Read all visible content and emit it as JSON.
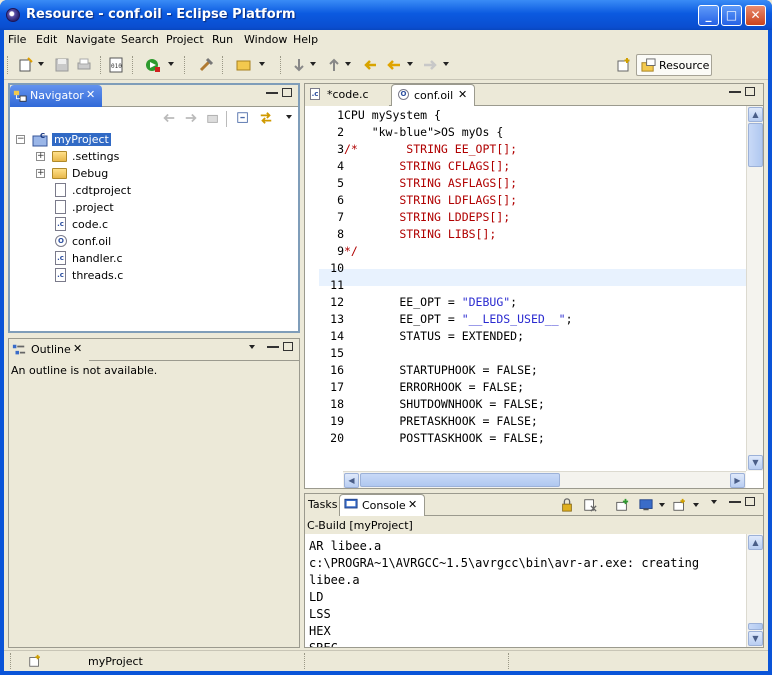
{
  "window": {
    "title": "Resource - conf.oil - Eclipse Platform"
  },
  "menu": [
    "File",
    "Edit",
    "Navigate",
    "Search",
    "Project",
    "Run",
    "Window",
    "Help"
  ],
  "perspective": {
    "label": "Resource"
  },
  "navigator": {
    "tab_label": "Navigator",
    "items": [
      {
        "label": "myProject",
        "icon": "project-icon"
      },
      {
        "label": ".settings",
        "icon": "folder-icon"
      },
      {
        "label": "Debug",
        "icon": "folder-icon"
      },
      {
        "label": ".cdtproject",
        "icon": "file-icon"
      },
      {
        "label": ".project",
        "icon": "file-icon"
      },
      {
        "label": "code.c",
        "icon": "c-file-icon"
      },
      {
        "label": "conf.oil",
        "icon": "oil-file-icon"
      },
      {
        "label": "handler.c",
        "icon": "c-file-icon"
      },
      {
        "label": "threads.c",
        "icon": "c-file-icon"
      }
    ]
  },
  "outline": {
    "tab_label": "Outline",
    "message": "An outline is not available."
  },
  "editor": {
    "tabs": [
      {
        "label": "*code.c"
      },
      {
        "label": "conf.oil"
      }
    ],
    "lines": [
      {
        "n": "1",
        "text": "CPU mySystem {"
      },
      {
        "n": "2",
        "text": "    OS myOs {"
      },
      {
        "n": "3",
        "text": "/*       STRING EE_OPT[];"
      },
      {
        "n": "4",
        "text": "        STRING CFLAGS[];"
      },
      {
        "n": "5",
        "text": "        STRING ASFLAGS[];"
      },
      {
        "n": "6",
        "text": "        STRING LDFLAGS[];"
      },
      {
        "n": "7",
        "text": "        STRING LDDEPS[];"
      },
      {
        "n": "8",
        "text": "        STRING LIBS[];"
      },
      {
        "n": "9",
        "text": "*/"
      },
      {
        "n": "10",
        "text": ""
      },
      {
        "n": "11",
        "text": ""
      },
      {
        "n": "12",
        "text": "        EE_OPT = \"DEBUG\";"
      },
      {
        "n": "13",
        "text": "        EE_OPT = \"__LEDS_USED__\";"
      },
      {
        "n": "14",
        "text": "        STATUS = EXTENDED;"
      },
      {
        "n": "15",
        "text": ""
      },
      {
        "n": "16",
        "text": "        STARTUPHOOK = FALSE;"
      },
      {
        "n": "17",
        "text": "        ERRORHOOK = FALSE;"
      },
      {
        "n": "18",
        "text": "        SHUTDOWNHOOK = FALSE;"
      },
      {
        "n": "19",
        "text": "        PRETASKHOOK = FALSE;"
      },
      {
        "n": "20",
        "text": "        POSTTASKHOOK = FALSE;"
      }
    ]
  },
  "console": {
    "tabs": [
      {
        "label": "Tasks"
      },
      {
        "label": "Console"
      }
    ],
    "header": "C-Build [myProject]",
    "lines": [
      "AR libee.a",
      "c:\\PROGRA~1\\AVRGCC~1.5\\avrgcc\\bin\\avr-ar.exe: creating",
      "libee.a",
      "LD",
      "LSS",
      "HEX",
      "SREC"
    ]
  },
  "status": {
    "selection": "myProject"
  },
  "colors": {
    "titlebar": "#0a54d8",
    "active_tab": "#3169d8",
    "selection": "#316ac5",
    "keyword_red": "#b00000",
    "keyword_blue": "#0000c8",
    "string": "#2a2ad0"
  }
}
